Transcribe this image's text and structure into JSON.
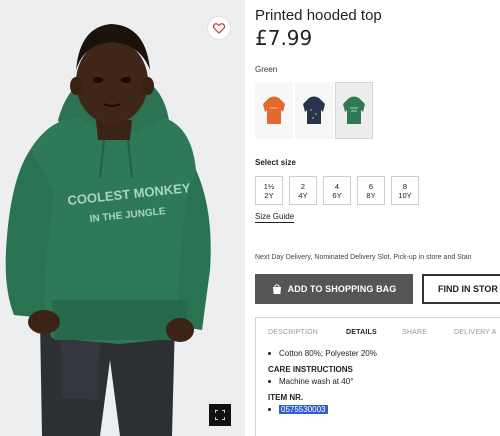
{
  "product": {
    "title": "Printed hooded top",
    "price": "£7.99",
    "color_label": "Green",
    "hoodie_print_line1": "COOLEST MONKEY",
    "hoodie_print_line2": "IN THE JUNGLE"
  },
  "swatches": [
    {
      "name": "orange",
      "color": "#e36a2e",
      "selected": false
    },
    {
      "name": "navy",
      "color": "#2a3448",
      "selected": false
    },
    {
      "name": "green",
      "color": "#2f7a55",
      "selected": true
    }
  ],
  "sizes": {
    "label": "Select size",
    "options": [
      {
        "top": "1½",
        "bottom": "2Y"
      },
      {
        "top": "2",
        "bottom": "4Y"
      },
      {
        "top": "4",
        "bottom": "6Y"
      },
      {
        "top": "6",
        "bottom": "8Y"
      },
      {
        "top": "8",
        "bottom": "10Y"
      }
    ],
    "guide": "Size Guide"
  },
  "delivery_text": "Next Day Delivery, Nominated Delivery Slot, Pick-up in store and Stan",
  "buttons": {
    "add_to_bag": "ADD TO SHOPPING BAG",
    "find_in_store": "FIND IN STOR"
  },
  "tabs": [
    "DESCRIPTION",
    "DETAILS",
    "SHARE",
    "DELIVERY A"
  ],
  "details": {
    "composition": "Cotton 80%; Polyester 20%",
    "care_title": "CARE INSTRUCTIONS",
    "care_item": "Machine wash at 40°",
    "item_nr_title": "ITEM NR.",
    "item_nr": "0575530003"
  },
  "colors": {
    "hoodie": "#2e7a57",
    "button_dark": "#555555",
    "selection": "#2f5fd0"
  },
  "icons": [
    "heart-icon",
    "shopping-bag-icon",
    "fullscreen-icon"
  ]
}
